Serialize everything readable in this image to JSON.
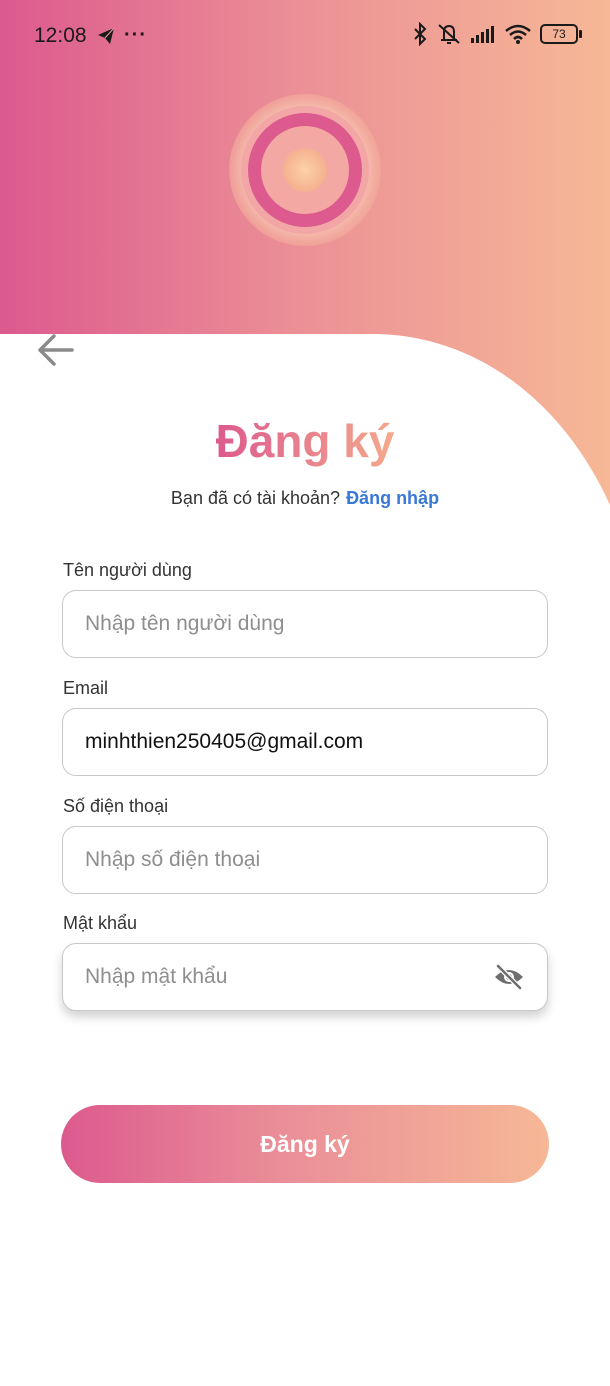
{
  "status_bar": {
    "time": "12:08",
    "more": "···",
    "battery": "73"
  },
  "colors": {
    "accent_pink": "#dc5a8e",
    "accent_peach": "#f6b896",
    "link_blue": "#3a78d6"
  },
  "header": {
    "title": "Đăng ký",
    "login_prompt": "Bạn đã có tài khoản?",
    "login_link": "Đăng nhập"
  },
  "form": {
    "username": {
      "label": "Tên người dùng",
      "placeholder": "Nhập tên người dùng",
      "value": ""
    },
    "email": {
      "label": "Email",
      "placeholder": "",
      "value": "minhthien250405@gmail.com"
    },
    "phone": {
      "label": "Số điện thoại",
      "placeholder": "Nhập số điện thoại",
      "value": ""
    },
    "password": {
      "label": "Mật khẩu",
      "placeholder": "Nhập mật khẩu",
      "value": ""
    },
    "submit_label": "Đăng ký"
  },
  "icons": {
    "back": "arrow-left-icon",
    "visibility": "eye-off-icon",
    "telegram": "telegram-icon",
    "bluetooth": "bluetooth-icon",
    "mute": "vibrate-off-icon",
    "signal": "signal-icon",
    "wifi": "wifi-icon",
    "battery": "battery-icon"
  }
}
